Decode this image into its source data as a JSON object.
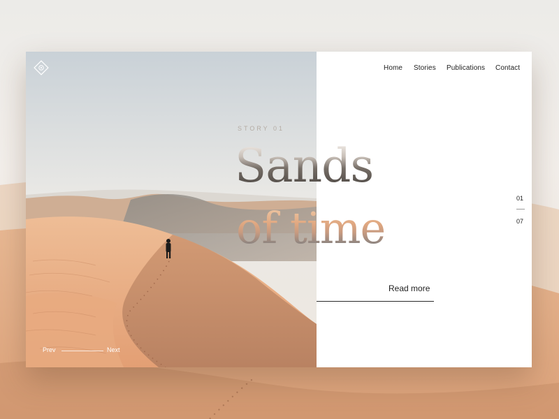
{
  "nav": {
    "items": [
      {
        "label": "Home"
      },
      {
        "label": "Stories"
      },
      {
        "label": "Publications"
      },
      {
        "label": "Contact"
      }
    ]
  },
  "hero": {
    "eyebrow": "STORY 01",
    "title_line1": "Sands",
    "title_line2": "of time",
    "cta_label": "Read more"
  },
  "pagination": {
    "current": "01",
    "total": "07"
  },
  "slider": {
    "prev_label": "Prev",
    "next_label": "Next"
  },
  "icons": {
    "logo": "diamond-logo-icon"
  },
  "colors": {
    "sand": "#e7a97c",
    "sky": "#e6e9ec",
    "panel": "#ffffff",
    "text": "#1e1e1e"
  }
}
